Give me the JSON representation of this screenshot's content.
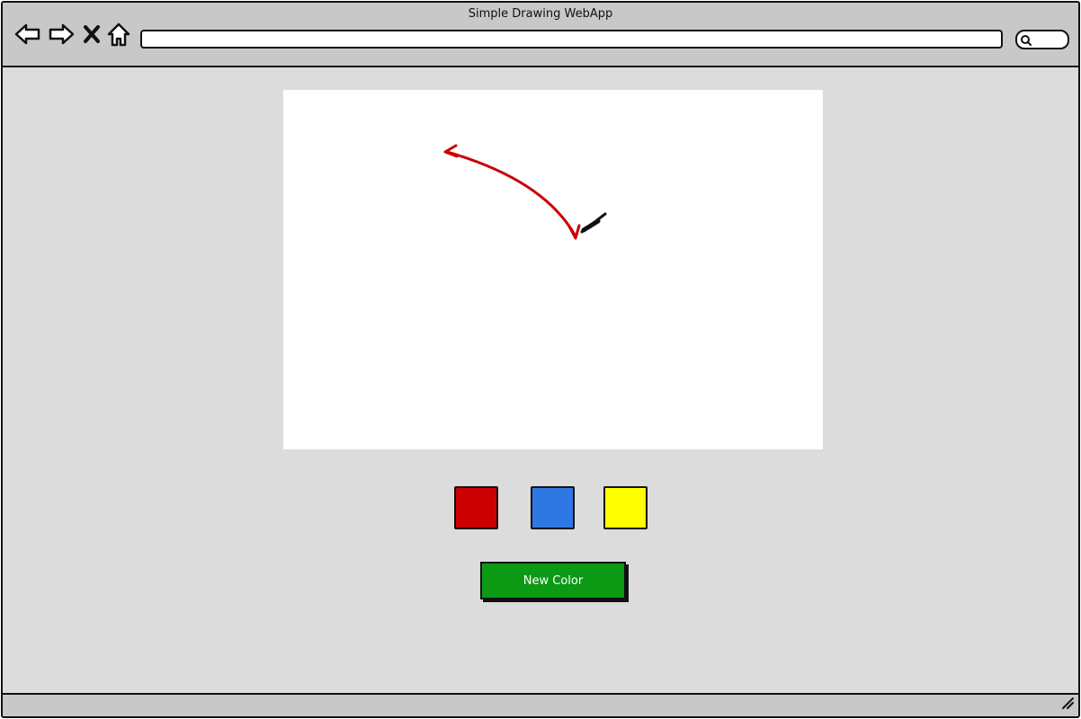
{
  "window": {
    "title": "Simple Drawing WebApp"
  },
  "toolbar": {
    "back_icon": "back-arrow-icon",
    "forward_icon": "forward-arrow-icon",
    "stop_icon": "close-icon",
    "home_icon": "home-icon",
    "address_value": "",
    "search_icon": "search-icon"
  },
  "canvas": {
    "stroke_color": "#cc0000"
  },
  "palette": {
    "swatches": [
      {
        "name": "red",
        "color": "#cc0000"
      },
      {
        "name": "blue",
        "color": "#2f78e4"
      },
      {
        "name": "yellow",
        "color": "#ffff00"
      }
    ]
  },
  "actions": {
    "new_color_label": "New Color",
    "new_color_bg": "#0c9a14"
  }
}
